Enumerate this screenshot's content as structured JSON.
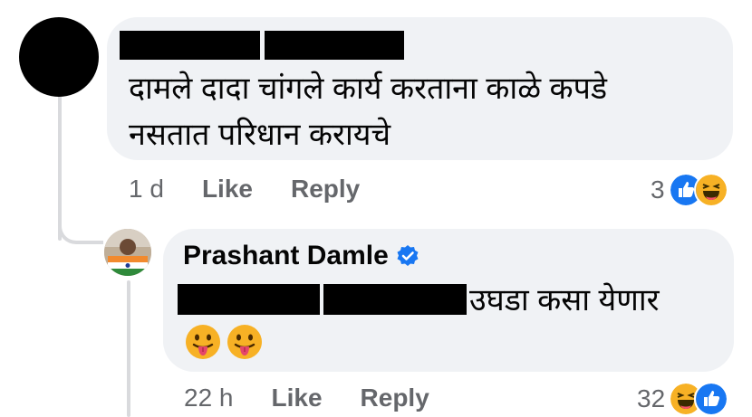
{
  "comment_1": {
    "author_redacted": true,
    "text_line_1": "दामले दादा चांगले कार्य करताना काळे कपडे",
    "text_line_2": "नसतात परिधान करायचे",
    "time": "1 d",
    "like_label": "Like",
    "reply_label": "Reply",
    "reaction_count": "3",
    "reactions": [
      "like-icon",
      "haha-icon"
    ]
  },
  "reply_1": {
    "author": "Prashant Damle",
    "verified": true,
    "text": "उघडा कसा येणार",
    "emojis": [
      "tongue-out-emoji",
      "tongue-out-emoji"
    ],
    "time": "22 h",
    "like_label": "Like",
    "reply_label": "Reply",
    "reaction_count": "32",
    "reactions": [
      "haha-icon",
      "like-icon"
    ]
  },
  "colors": {
    "bubble_bg": "#f0f2f5",
    "meta_gray": "#65676b",
    "like_blue": "#1877f2",
    "haha_yellow": "#f7b125",
    "thread_line": "#d9dadd"
  }
}
